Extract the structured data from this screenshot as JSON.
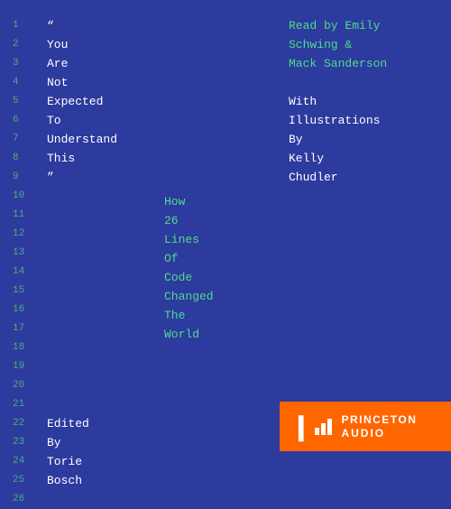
{
  "background_color": "#2d3a9e",
  "line_numbers": [
    "1",
    "2",
    "3",
    "4",
    "5",
    "6",
    "7",
    "8",
    "9",
    "10",
    "11",
    "12",
    "13",
    "14",
    "15",
    "16",
    "17",
    "18",
    "19",
    "20",
    "21",
    "22",
    "23",
    "24",
    "25",
    "26"
  ],
  "left_column": {
    "lines": [
      {
        "text": "“",
        "color": "white"
      },
      {
        "text": "You",
        "color": "white"
      },
      {
        "text": "Are",
        "color": "white"
      },
      {
        "text": "Not",
        "color": "white"
      },
      {
        "text": "Expected",
        "color": "white"
      },
      {
        "text": "To",
        "color": "white"
      },
      {
        "text": "Understand",
        "color": "white"
      },
      {
        "text": "This",
        "color": "white"
      },
      {
        "text": "”",
        "color": "white"
      },
      {
        "text": "",
        "color": "white"
      },
      {
        "text": "",
        "color": "white"
      },
      {
        "text": "",
        "color": "white"
      },
      {
        "text": "",
        "color": "white"
      },
      {
        "text": "",
        "color": "white"
      },
      {
        "text": "",
        "color": "white"
      },
      {
        "text": "",
        "color": "white"
      },
      {
        "text": "",
        "color": "white"
      },
      {
        "text": "",
        "color": "white"
      },
      {
        "text": "",
        "color": "white"
      },
      {
        "text": "",
        "color": "white"
      },
      {
        "text": "",
        "color": "white"
      },
      {
        "text": "Edited",
        "color": "white"
      },
      {
        "text": "By",
        "color": "white"
      },
      {
        "text": "Torie",
        "color": "white"
      },
      {
        "text": "Bosch",
        "color": "white"
      },
      {
        "text": "",
        "color": "white"
      }
    ]
  },
  "middle_column": {
    "lines": [
      {
        "text": "How",
        "color": "#4cdd8a"
      },
      {
        "text": "26",
        "color": "#4cdd8a"
      },
      {
        "text": "Lines",
        "color": "#4cdd8a"
      },
      {
        "text": "Of",
        "color": "#4cdd8a"
      },
      {
        "text": "Code",
        "color": "#4cdd8a"
      },
      {
        "text": "Changed",
        "color": "#4cdd8a"
      },
      {
        "text": "The",
        "color": "#4cdd8a"
      },
      {
        "text": "World",
        "color": "#4cdd8a"
      }
    ]
  },
  "right_column": {
    "lines": [
      {
        "text": "Read by Emily Schwing &",
        "color": "#4cdd8a"
      },
      {
        "text": "Mack Sanderson",
        "color": "#4cdd8a"
      },
      {
        "text": "",
        "color": "white"
      },
      {
        "text": "With",
        "color": "white"
      },
      {
        "text": "Illustrations",
        "color": "white"
      },
      {
        "text": "By",
        "color": "white"
      },
      {
        "text": "Kelly",
        "color": "white"
      },
      {
        "text": "Chudler",
        "color": "white"
      }
    ]
  },
  "bottom_bar": {
    "brand": "PRINCETON",
    "product": "AUDIO",
    "color": "#ff6600"
  }
}
